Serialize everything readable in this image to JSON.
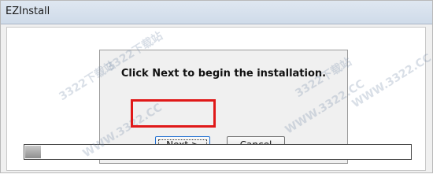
{
  "window": {
    "title": "EZInstall"
  },
  "dialog": {
    "message": "Click Next to begin the installation.",
    "next_label": "Next >",
    "cancel_label": "Cancel"
  },
  "progress": {
    "value_fraction": 0.04
  },
  "watermarks": [
    "3322下载站",
    "WWW.3322.CC",
    "3322下载站",
    "WWW.3322.CC",
    "3322下载站",
    "WWW.3322.CC"
  ],
  "colors": {
    "highlight": "#e01919",
    "progress_fill": "#8f8f8f"
  }
}
